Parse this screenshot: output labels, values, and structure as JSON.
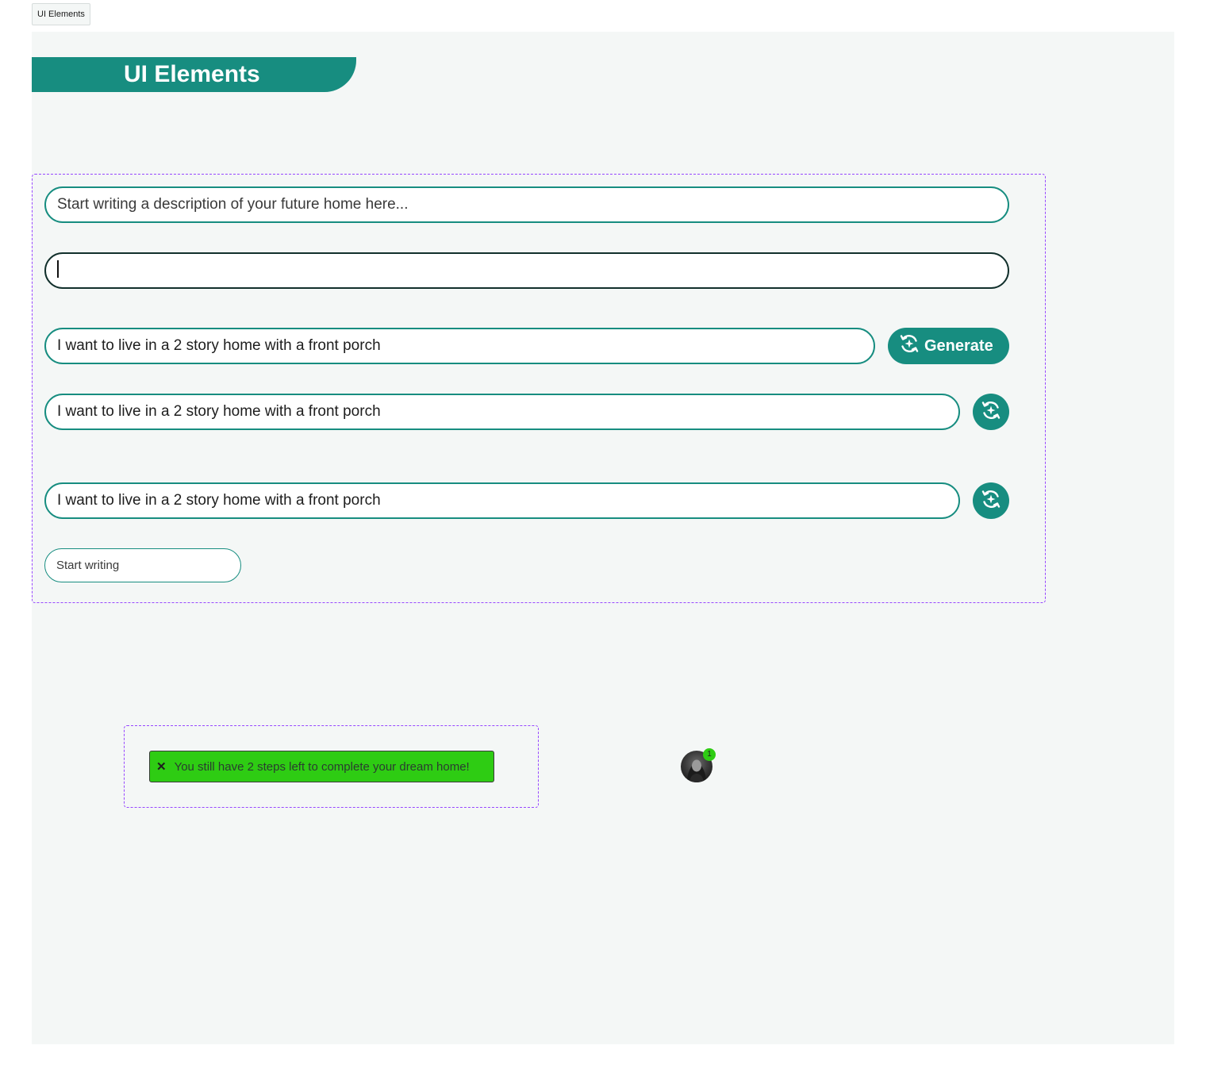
{
  "tab": {
    "label": "UI Elements"
  },
  "header": {
    "title": "UI Elements"
  },
  "inputs": {
    "placeholder_field": {
      "placeholder": "Start writing a description of your future home here..."
    },
    "focused_field": {
      "value": ""
    },
    "generate_field": {
      "value": "I want to live in a 2 story home with a front porch"
    },
    "icon_field_1": {
      "value": "I want to live in a 2 story home with a front porch"
    },
    "icon_field_2": {
      "value": "I want to live in a 2 story home with a front porch"
    },
    "small_field": {
      "placeholder": "Start writing"
    }
  },
  "buttons": {
    "generate_label": "Generate",
    "generate_icon": "sparkle-refresh-icon",
    "icon_button_icon": "sparkle-refresh-icon"
  },
  "toast": {
    "close_icon": "close-icon",
    "close_glyph": "✕",
    "message": "You still have 2 steps left to complete your dream home!"
  },
  "avatar": {
    "badge_count": "1"
  },
  "colors": {
    "brand": "#178d80",
    "canvas": "#f4f7f6",
    "frame_outline": "#9747ff",
    "toast_bg": "#2ecc13",
    "focus_border": "#12302c"
  }
}
